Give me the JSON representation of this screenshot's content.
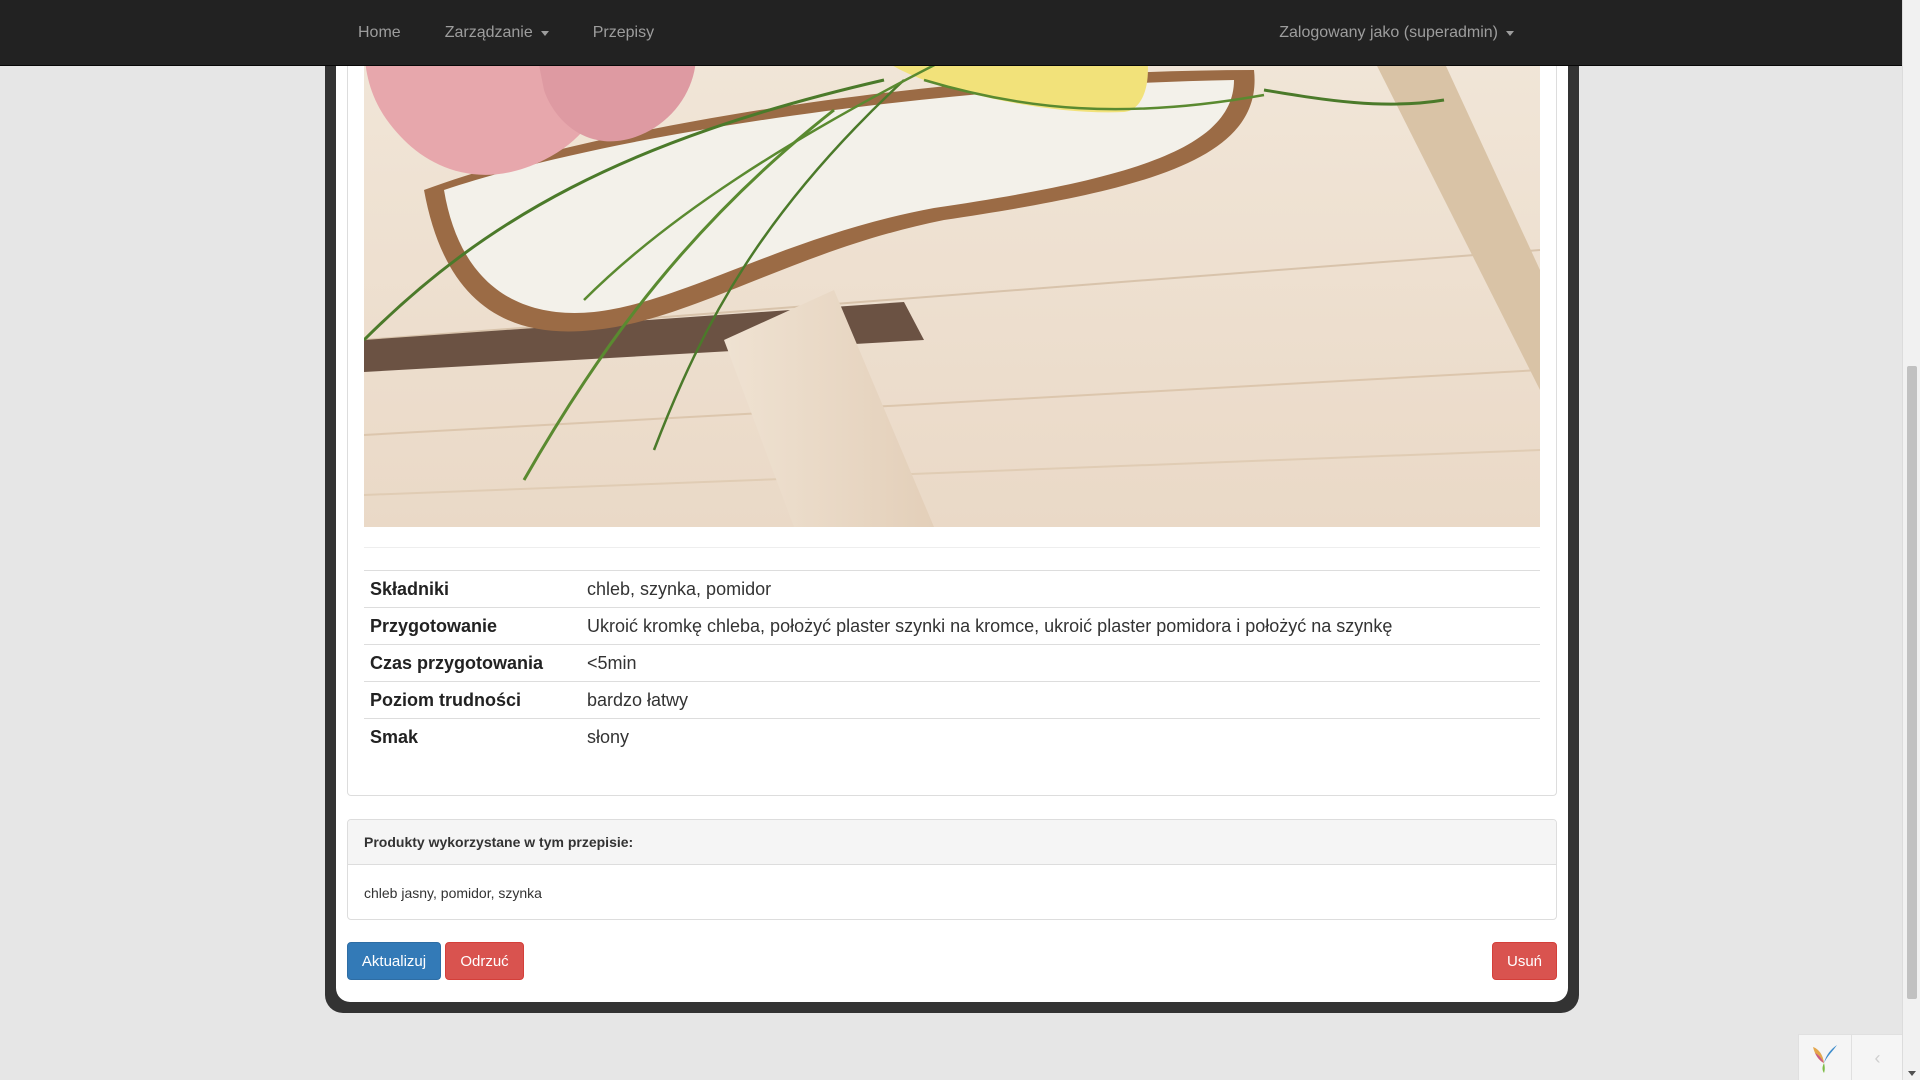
{
  "navbar": {
    "items": [
      {
        "label": "Home"
      },
      {
        "label": "Zarządzanie"
      },
      {
        "label": "Przepisy"
      }
    ],
    "user_menu": "Zalogowany jako (superadmin)"
  },
  "recipe": {
    "details": [
      {
        "label": "Składniki",
        "value": "chleb, szynka, pomidor"
      },
      {
        "label": "Przygotowanie",
        "value": "Ukroić kromkę chleba, położyć plaster szynki na kromce, ukroić plaster pomidora i położyć na szynkę"
      },
      {
        "label": "Czas przygotowania",
        "value": "<5min"
      },
      {
        "label": "Poziom trudności",
        "value": "bardzo łatwy"
      },
      {
        "label": "Smak",
        "value": "słony"
      }
    ]
  },
  "products": {
    "heading": "Produkty wykorzystane w tym przepisie:",
    "list": "chleb jasny, pomidor, szynka"
  },
  "actions": {
    "update": "Aktualizuj",
    "reject": "Odrzuć",
    "delete": "Usuń"
  },
  "debug": {
    "toggle_glyph": "‹"
  },
  "colors": {
    "navbar_bg": "#222222",
    "primary": "#337ab7",
    "danger": "#d9534f",
    "frame": "#333333"
  }
}
